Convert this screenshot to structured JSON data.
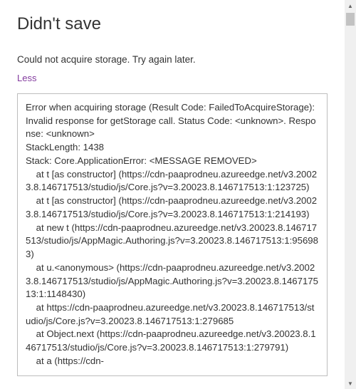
{
  "dialog": {
    "title": "Didn't save",
    "message": "Could not acquire storage. Try again later.",
    "toggle_label": "Less",
    "error_details": "Error when acquiring storage (Result Code: FailedToAcquireStorage): Invalid response for getStorage call. Status Code: <unknown>. Response: <unknown>\nStackLength: 1438\nStack: Core.ApplicationError: <MESSAGE REMOVED>\n    at t [as constructor] (https://cdn-paaprodneu.azureedge.net/v3.20023.8.146717513/studio/js/Core.js?v=3.20023.8.146717513:1:123725)\n    at t [as constructor] (https://cdn-paaprodneu.azureedge.net/v3.20023.8.146717513/studio/js/Core.js?v=3.20023.8.146717513:1:214193)\n    at new t (https://cdn-paaprodneu.azureedge.net/v3.20023.8.146717513/studio/js/AppMagic.Authoring.js?v=3.20023.8.146717513:1:956983)\n    at u.<anonymous> (https://cdn-paaprodneu.azureedge.net/v3.20023.8.146717513/studio/js/AppMagic.Authoring.js?v=3.20023.8.146717513:1:1148430)\n    at https://cdn-paaprodneu.azureedge.net/v3.20023.8.146717513/studio/js/Core.js?v=3.20023.8.146717513:1:279685\n    at Object.next (https://cdn-paaprodneu.azureedge.net/v3.20023.8.146717513/studio/js/Core.js?v=3.20023.8.146717513:1:279791)\n    at a (https://cdn-"
  }
}
